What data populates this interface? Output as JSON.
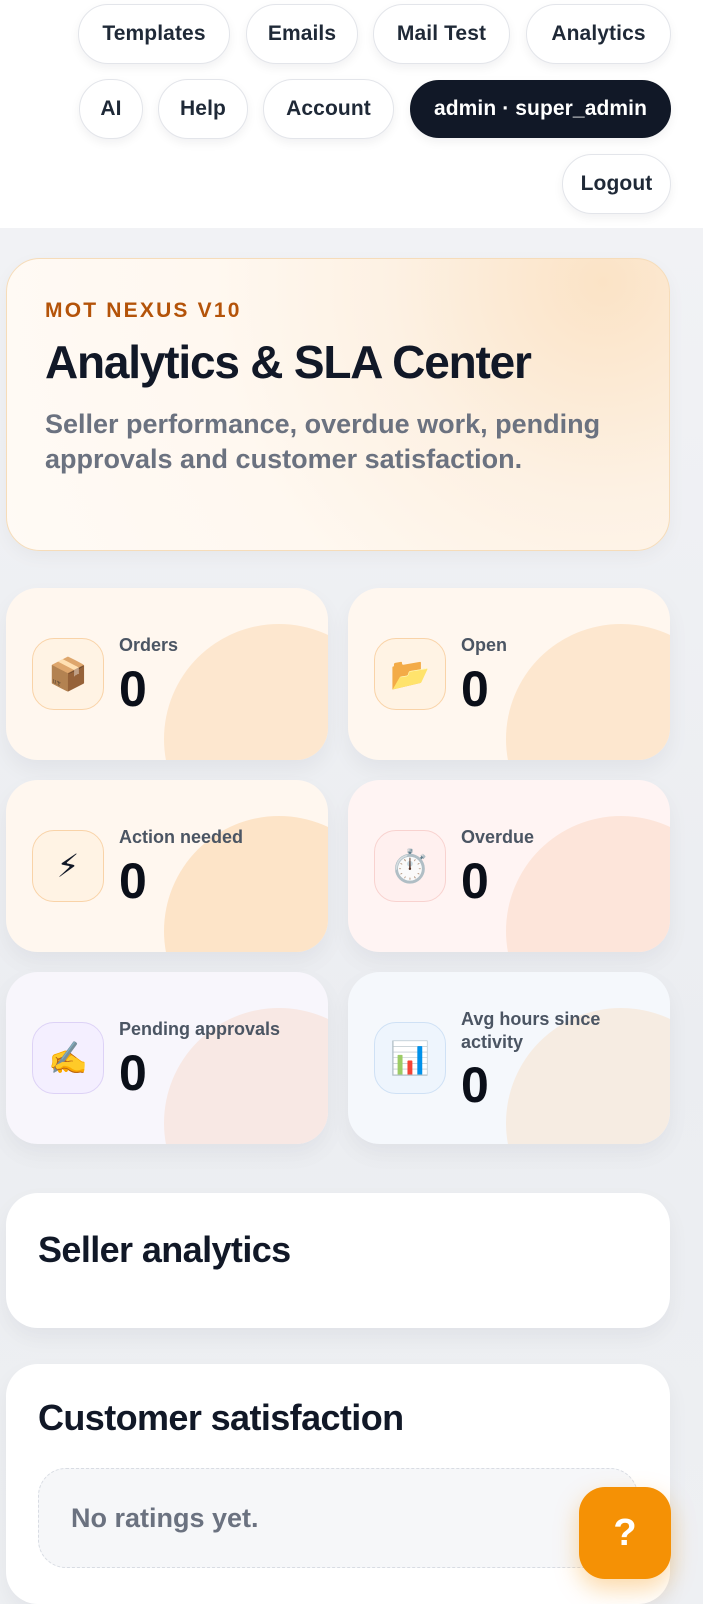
{
  "nav": {
    "templates": "Templates",
    "emails": "Emails",
    "mail_test": "Mail Test",
    "analytics": "Analytics",
    "ai": "AI",
    "help": "Help",
    "account": "Account",
    "user": "admin · super_admin",
    "logout": "Logout"
  },
  "hero": {
    "eyebrow": "MOT NEXUS V10",
    "title": "Analytics & SLA Center",
    "subtitle": "Seller performance, overdue work, pending approvals and customer satisfaction."
  },
  "stats": [
    {
      "label": "Orders",
      "value": "0",
      "icon": "package-icon",
      "glyph": "📦"
    },
    {
      "label": "Open",
      "value": "0",
      "icon": "open-folder-icon",
      "glyph": "📂"
    },
    {
      "label": "Action needed",
      "value": "0",
      "icon": "lightning-icon",
      "glyph": "⚡"
    },
    {
      "label": "Overdue",
      "value": "0",
      "icon": "stopwatch-icon",
      "glyph": "⏱️"
    },
    {
      "label": "Pending approvals",
      "value": "0",
      "icon": "writing-hand-icon",
      "glyph": "✍️"
    },
    {
      "label": "Avg hours since activity",
      "value": "0",
      "icon": "bar-chart-icon",
      "glyph": "📊"
    }
  ],
  "seller_analytics": {
    "title": "Seller analytics"
  },
  "customer_satisfaction": {
    "title": "Customer satisfaction",
    "empty_text": "No ratings yet."
  },
  "help_button": {
    "label": "?"
  },
  "colors": {
    "accent": "#f59105",
    "eyebrow": "#b45309",
    "dark_pill": "#111827",
    "muted_text": "#6b7280"
  }
}
